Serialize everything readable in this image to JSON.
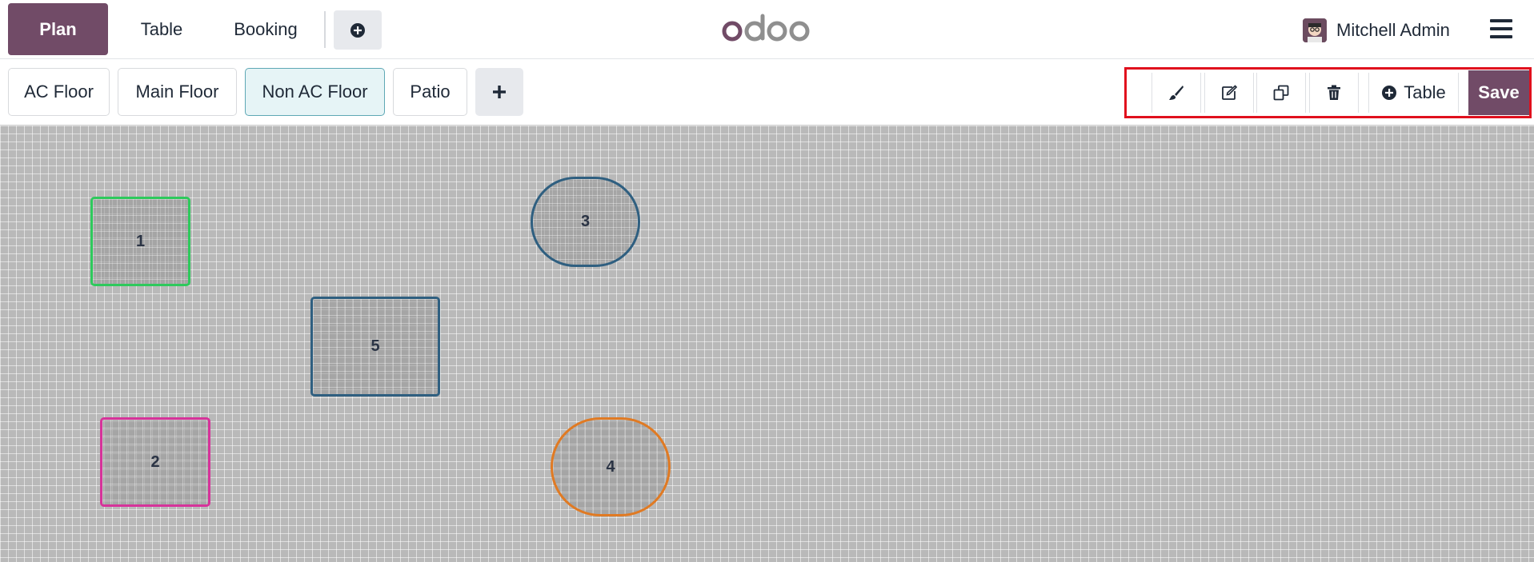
{
  "navbar": {
    "tabs": [
      {
        "label": "Plan",
        "active": true
      },
      {
        "label": "Table",
        "active": false
      },
      {
        "label": "Booking",
        "active": false
      }
    ],
    "add_icon": "plus-circle-icon",
    "logo_text": "odoo",
    "user_name": "Mitchell Admin",
    "menu_icon": "hamburger-icon"
  },
  "floors": {
    "tabs": [
      {
        "label": "AC Floor",
        "active": false
      },
      {
        "label": "Main Floor",
        "active": false
      },
      {
        "label": "Non AC Floor",
        "active": true
      },
      {
        "label": "Patio",
        "active": false
      }
    ],
    "add_icon": "plus-icon"
  },
  "edit_toolbar": {
    "tools": [
      "brush-icon",
      "rename-icon",
      "copy-icon",
      "trash-icon"
    ],
    "add_table_label": "Table",
    "save_label": "Save"
  },
  "tables": [
    {
      "number": "1",
      "shape": "square",
      "color": "#2ec95c"
    },
    {
      "number": "2",
      "shape": "square",
      "color": "#d6339a"
    },
    {
      "number": "3",
      "shape": "round",
      "color": "#2f5f80"
    },
    {
      "number": "4",
      "shape": "round",
      "color": "#e07a23"
    },
    {
      "number": "5",
      "shape": "square",
      "color": "#2f5f80"
    }
  ],
  "colors": {
    "brand": "#714b67",
    "highlight_border": "#e0101d",
    "active_floor_bg": "#e6f4f6"
  }
}
